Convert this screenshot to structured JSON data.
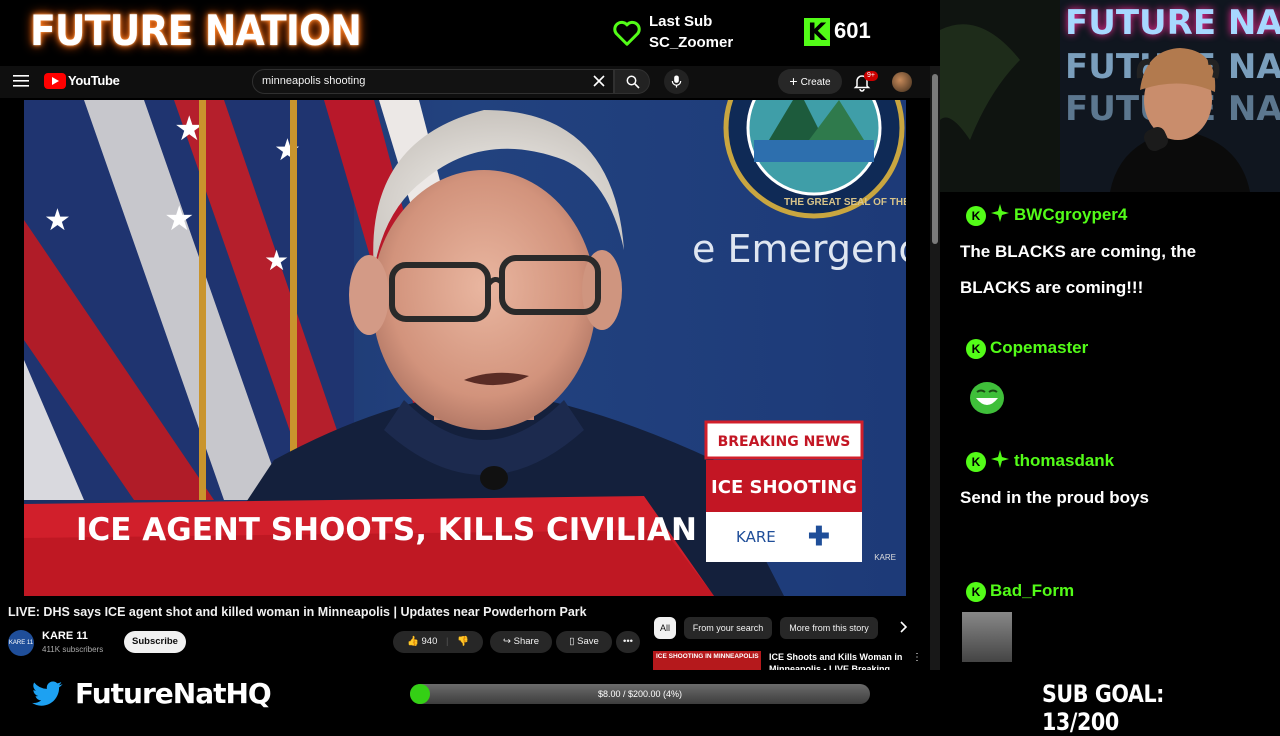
{
  "overlay": {
    "logo_text": "FUTURE NATION",
    "last_sub_label": "Last Sub",
    "last_sub_name": "SC_Zoomer",
    "kick_followers": "601",
    "twitter_handle": "FutureNatHQ",
    "goal_text": "$8.00 / $200.00 (4%)",
    "goal_fraction": 0.04,
    "sub_goal": "SUB GOAL: 13/200",
    "accent_color": "#53fc18"
  },
  "youtube": {
    "brand": "YouTube",
    "search_value": "minneapolis shooting",
    "create_label": "Create",
    "notif_badge": "9+",
    "video_title": "LIVE: DHS says ICE agent shot and killed woman in Minneapolis | Updates near Powderhorn Park",
    "channel_name": "KARE 11",
    "channel_avatar_text": "KARE 11",
    "channel_subs": "411K subscribers",
    "subscribe_label": "Subscribe",
    "like_count": "940",
    "share_label": "Share",
    "save_label": "Save",
    "chips": [
      "All",
      "From your search",
      "More from this story"
    ],
    "rec_thumb_label": "ICE SHOOTING IN MINNEAPOLIS",
    "rec_title": "ICE Shoots and Kills Woman in Minneapolis - LIVE Breaking"
  },
  "video_frame": {
    "seal_text": "THE GREAT SEAL OF THE STATE OF MINNESOTA",
    "backdrop_text": "e Emergency",
    "breaking_label": "BREAKING NEWS",
    "topic_label": "ICE SHOOTING",
    "headline": "ICE AGENT SHOOTS, KILLS CIVILIAN",
    "station_logo": "KARE",
    "watermark": "KARE"
  },
  "chat": [
    {
      "user": "BWCgroyper4",
      "message": "The BLACKS are coming, the BLACKS are coming!!!"
    },
    {
      "user": "Copemaster",
      "message": ""
    },
    {
      "user": "thomasdank",
      "message": "Send in the proud boys"
    },
    {
      "user": "Bad_Form",
      "message": ""
    }
  ]
}
